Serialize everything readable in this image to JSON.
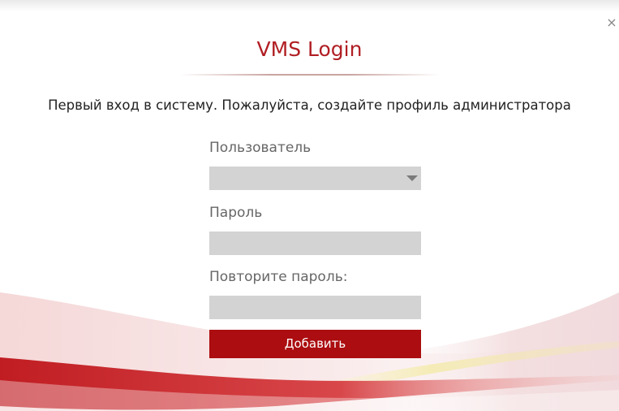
{
  "dialog": {
    "close_glyph": "×",
    "title": "VMS Login",
    "subtitle": "Первый вход в систему. Пожалуйста, создайте профиль администратора",
    "user_label": "Пользователь",
    "user_value": "",
    "password_label": "Пароль",
    "password_value": "",
    "repeat_label": "Повторите пароль:",
    "repeat_value": "",
    "add_label": "Добавить"
  },
  "icons": {
    "close": "close-icon",
    "dropdown": "chevron-down-icon"
  },
  "colors": {
    "accent": "#b01e23",
    "button": "#ab0d10",
    "field": "#d3d3d3",
    "label": "#666666"
  }
}
